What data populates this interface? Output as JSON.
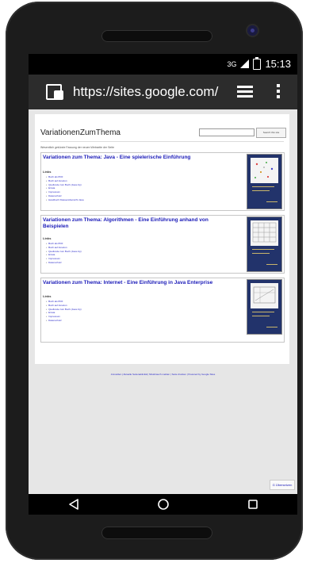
{
  "status_bar": {
    "network": "3G",
    "time": "15:13"
  },
  "browser": {
    "url": "https://sites.google.com/"
  },
  "site": {
    "title": "VariationenZumThema",
    "search_button": "Search this site",
    "notice": "Wesentlich gekürzte Fassung der neuen Webseite der Seite"
  },
  "cards": [
    {
      "title": "Variationen zum Thema: Java - Eine spielerische Einführung",
      "links_heading": "Links",
      "links": [
        "Buch als PDF",
        "Buch auf Amazon",
        "Quellcode zum Buch (Java.zip)",
        "Errata",
        "Impressum",
        "Datenschutz",
        "Handbuch Klassenübersicht Java"
      ]
    },
    {
      "title": "Variationen zum Thema: Algorithmen - Eine Einführung anhand von Beispielen",
      "links_heading": "Links",
      "links": [
        "Buch als PDF",
        "Buch auf Amazon",
        "Quellcode zum Buch (Java.zip)",
        "Errata",
        "Impressum",
        "Datenschutz"
      ]
    },
    {
      "title": "Variationen zum Thema: Internet - Eine Einführung in Java Enterprise",
      "links_heading": "Links",
      "links": [
        "Buch als PDF",
        "Buch auf Amazon",
        "Quellcode zum Buch (Java.zip)",
        "Errata",
        "Impressum",
        "Datenschutz"
      ]
    }
  ],
  "footer": {
    "text": "Anmelden | Aktuelle Seitenaktivität | Missbrauch melden | Seite drucken | Powered by Google Sites"
  },
  "translate_label": "G Übersetzen"
}
